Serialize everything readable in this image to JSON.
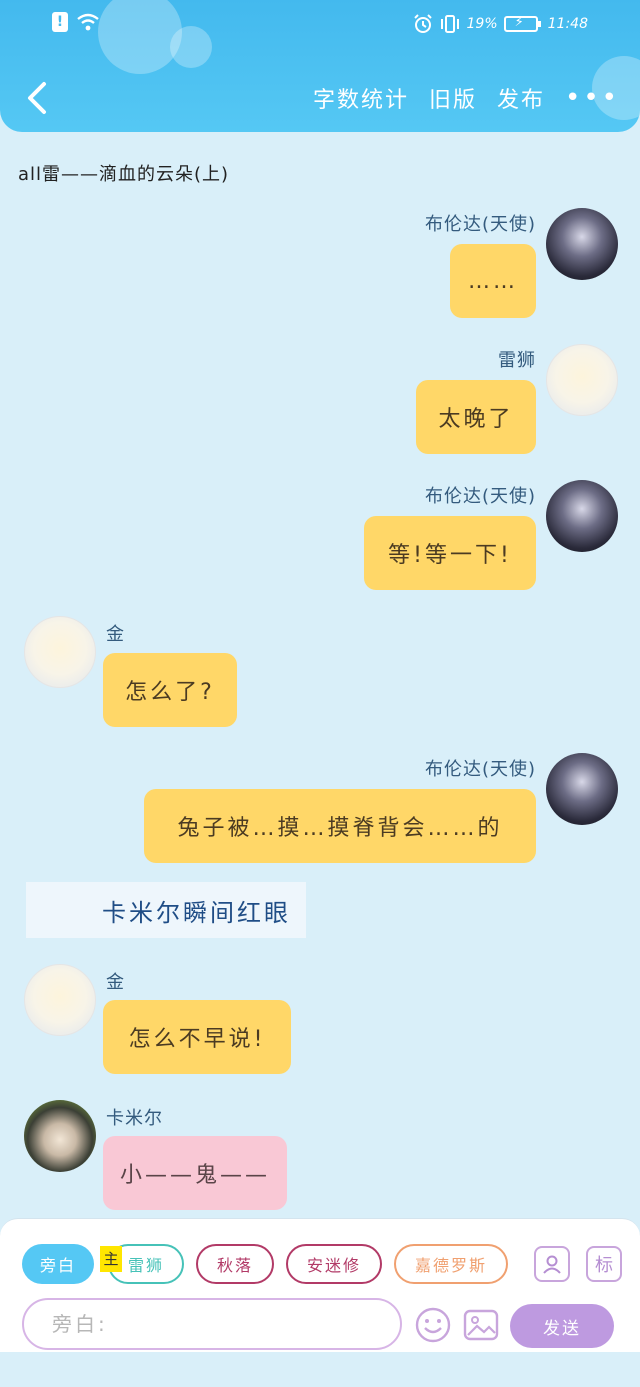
{
  "status_bar": {
    "battery_percent": "19%",
    "time": "11:48"
  },
  "header": {
    "word_count": "字数统计",
    "old_version": "旧版",
    "publish": "发布",
    "more": "•••"
  },
  "chat": {
    "title": "all雷——滴血的云朵(上)",
    "messages": [
      {
        "side": "right",
        "name": "布伦达(天使)",
        "text": "……",
        "color": "yellow"
      },
      {
        "side": "right",
        "name": "雷狮",
        "text": "太晚了",
        "color": "yellow"
      },
      {
        "side": "right",
        "name": "布伦达(天使)",
        "text": "等!等一下!",
        "color": "yellow"
      },
      {
        "side": "left",
        "name": "金",
        "text": "怎么了?",
        "color": "yellow"
      },
      {
        "side": "right",
        "name": "布伦达(天使)",
        "text": "兔子被…摸…摸脊背会……的",
        "color": "yellow"
      },
      {
        "side": "narration",
        "text": "卡米尔瞬间红眼"
      },
      {
        "side": "left",
        "name": "金",
        "text": "怎么不早说!",
        "color": "yellow"
      },
      {
        "side": "left",
        "name": "卡米尔",
        "text": "小——鬼——",
        "color": "pink"
      }
    ]
  },
  "panel": {
    "roles": [
      {
        "label": "旁白",
        "active": true,
        "color": "#55c8f4"
      },
      {
        "label": "雷狮",
        "active": false,
        "color": "#46c2b8"
      },
      {
        "label": "秋落",
        "active": false,
        "color": "#b23a67"
      },
      {
        "label": "安迷修",
        "active": false,
        "color": "#b23a67"
      },
      {
        "label": "嘉德罗斯",
        "active": false,
        "color": "#f0a070"
      }
    ],
    "host_tag": "主",
    "tag_button": "标",
    "input_placeholder": "旁白:",
    "send": "发送"
  },
  "colors": {
    "header": "#43b9ee",
    "background": "#d9eff9",
    "yellow_bubble": "#ffd768",
    "pink_bubble": "#f9c8d5",
    "send": "#be9ae0"
  }
}
